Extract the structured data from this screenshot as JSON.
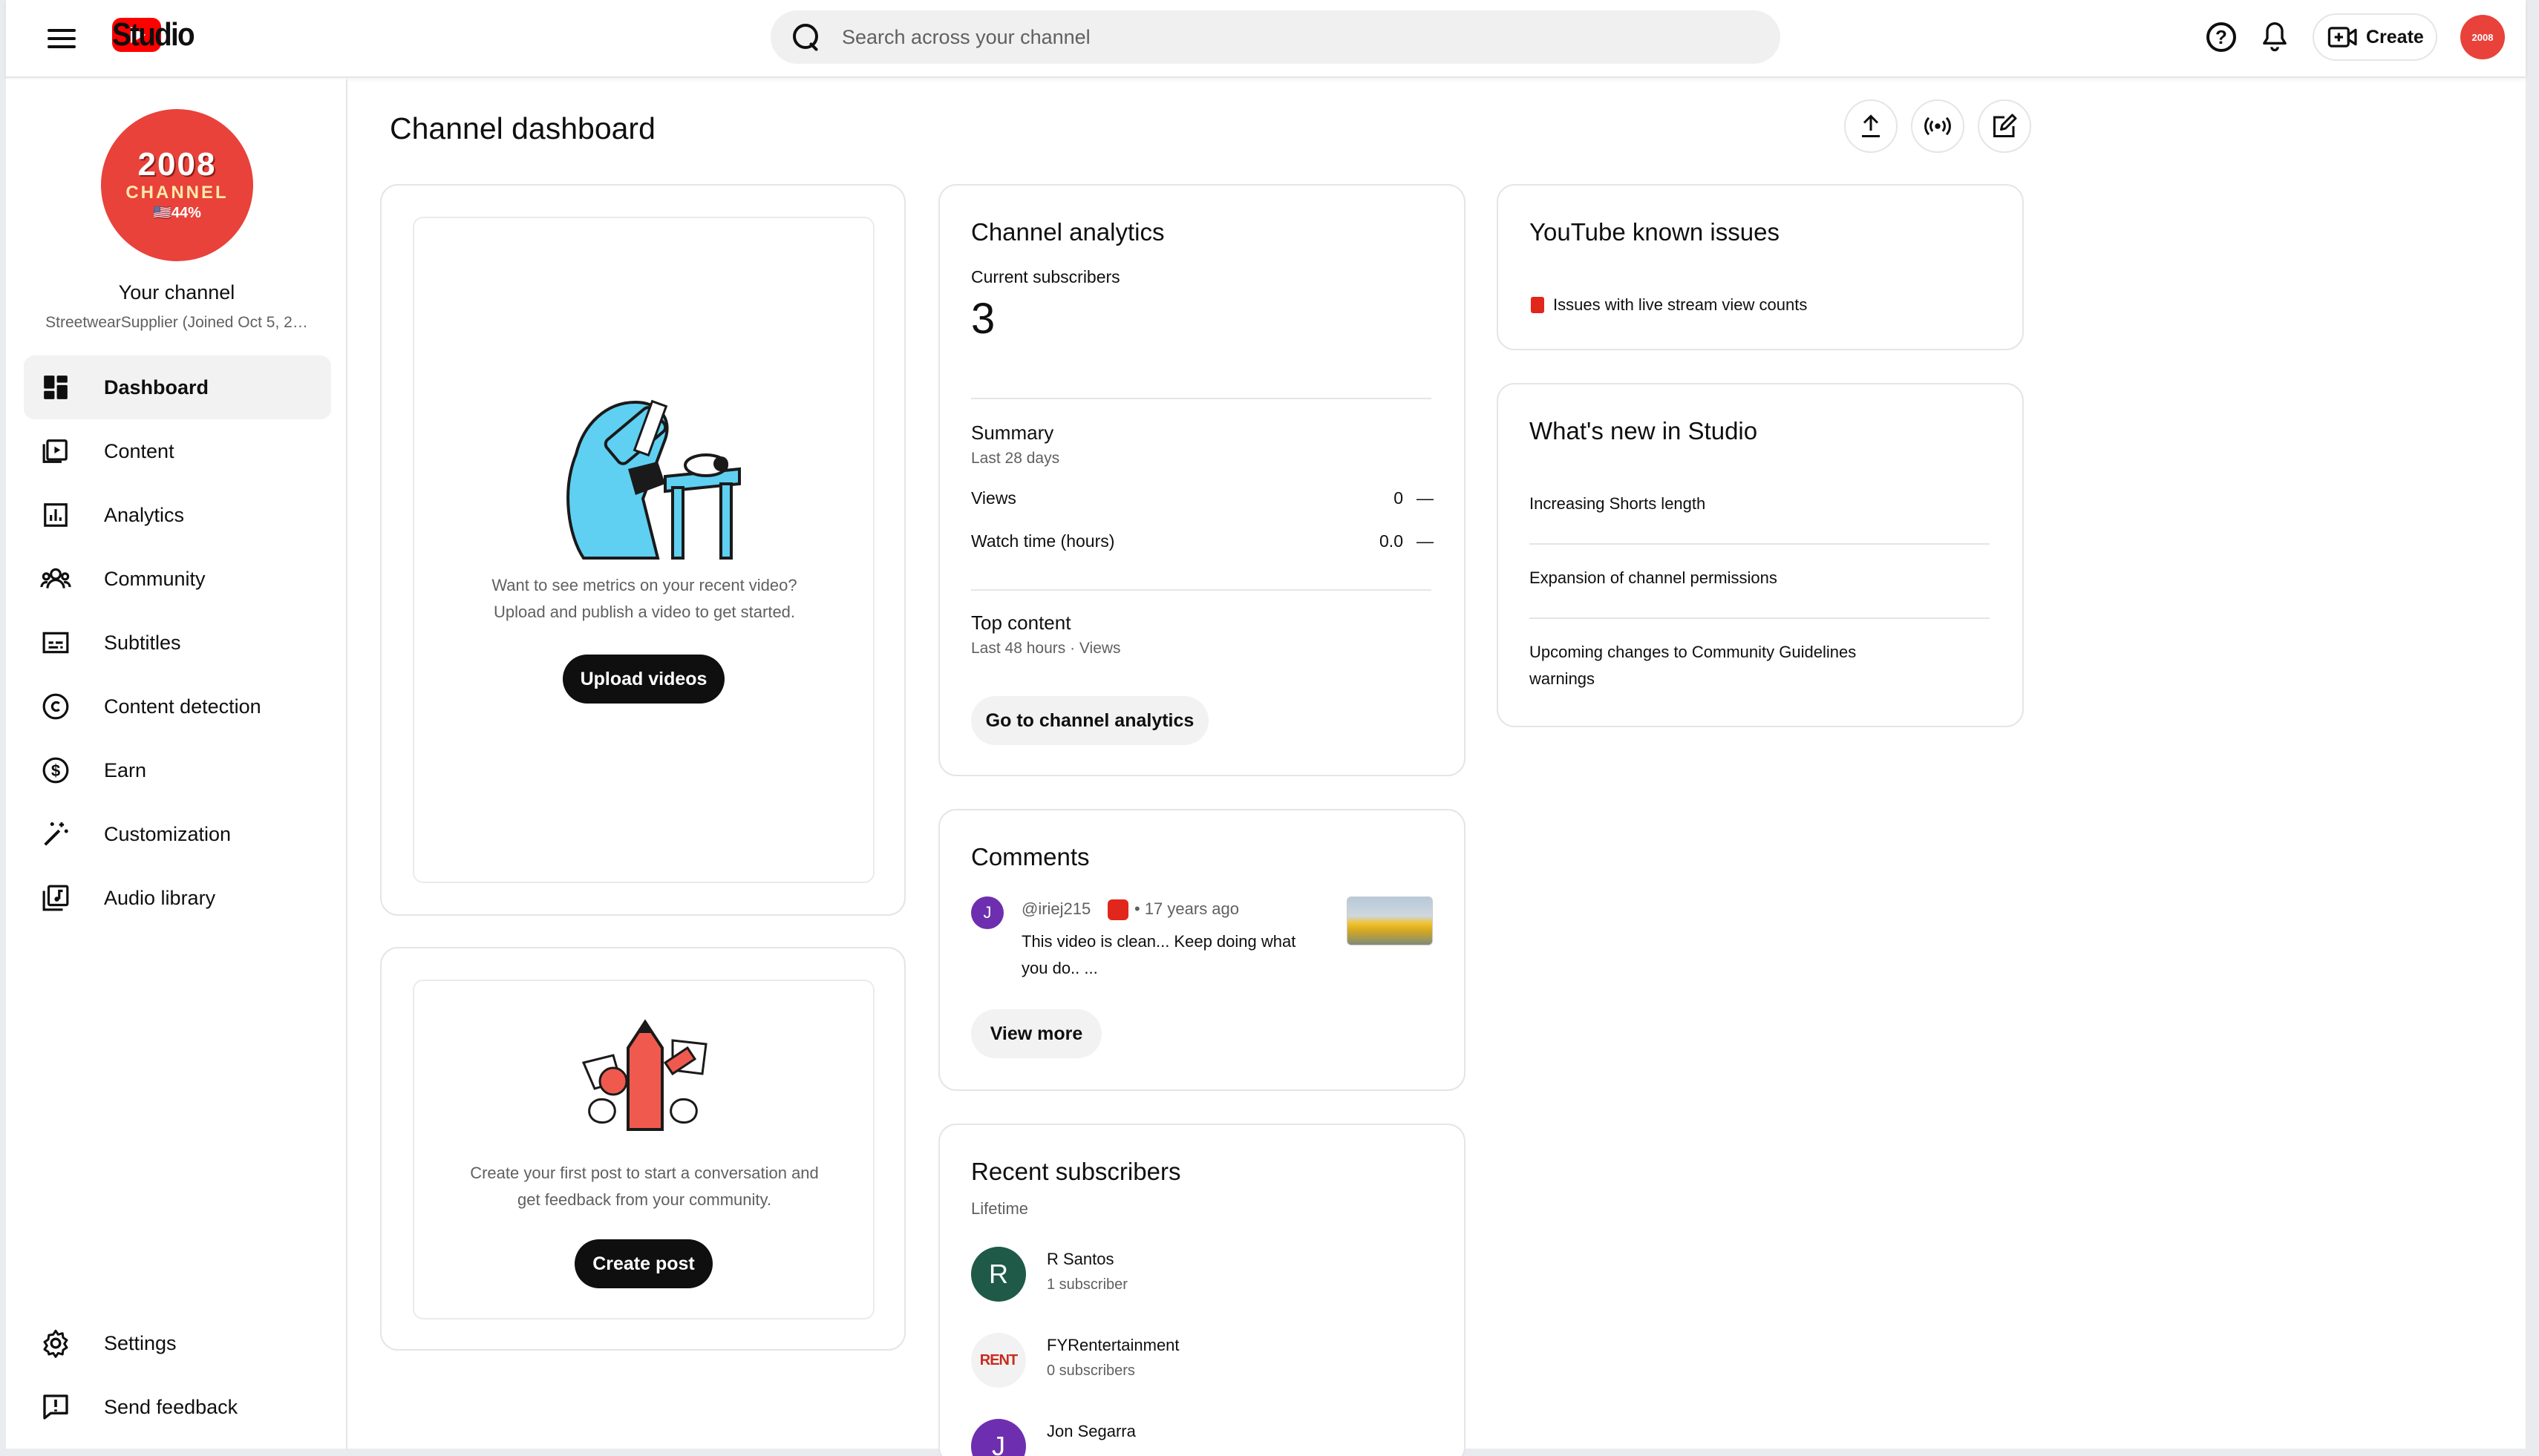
{
  "header": {
    "app_name": "Studio",
    "search_placeholder": "Search across your channel",
    "create_label": "Create",
    "avatar_text": "2008"
  },
  "sidebar": {
    "avatar": {
      "line1": "2008",
      "line2": "CHANNEL",
      "line3": "🇺🇸44%"
    },
    "your_channel": "Your channel",
    "channel_sub": "StreetwearSupplier (Joined Oct 5, 2…",
    "items": [
      {
        "label": "Dashboard",
        "icon": "dashboard-icon",
        "active": true
      },
      {
        "label": "Content",
        "icon": "content-icon"
      },
      {
        "label": "Analytics",
        "icon": "analytics-icon"
      },
      {
        "label": "Community",
        "icon": "community-icon"
      },
      {
        "label": "Subtitles",
        "icon": "subtitles-icon"
      },
      {
        "label": "Content detection",
        "icon": "copyright-icon"
      },
      {
        "label": "Earn",
        "icon": "dollar-icon"
      },
      {
        "label": "Customization",
        "icon": "magic-wand-icon"
      },
      {
        "label": "Audio library",
        "icon": "audio-library-icon"
      }
    ],
    "bottom": [
      {
        "label": "Settings",
        "icon": "gear-icon"
      },
      {
        "label": "Send feedback",
        "icon": "feedback-icon"
      }
    ]
  },
  "main": {
    "title": "Channel dashboard",
    "video_card": {
      "text_line1": "Want to see metrics on your recent video?",
      "text_line2": "Upload and publish a video to get started.",
      "button": "Upload videos"
    },
    "post_card": {
      "text_line1": "Create your first post to start a conversation and",
      "text_line2": "get feedback from your community.",
      "button": "Create post"
    },
    "analytics": {
      "title": "Channel analytics",
      "subs_label": "Current subscribers",
      "subs_value": "3",
      "summary_title": "Summary",
      "summary_period": "Last 28 days",
      "rows": [
        {
          "label": "Views",
          "value": "0",
          "trend": "—"
        },
        {
          "label": "Watch time (hours)",
          "value": "0.0",
          "trend": "—"
        }
      ],
      "top_title": "Top content",
      "top_period": "Last 48 hours · Views",
      "button": "Go to channel analytics"
    },
    "comments": {
      "title": "Comments",
      "author_initial": "J",
      "author": "@iriej215",
      "time": "• 17 years ago",
      "text_line1": "This video is clean... Keep doing what",
      "text_line2": "you do.. ...",
      "button": "View more"
    },
    "recent_subs": {
      "title": "Recent subscribers",
      "period": "Lifetime",
      "items": [
        {
          "initial": "R",
          "name": "R Santos",
          "count": "1 subscriber",
          "color": "#1e5a47"
        },
        {
          "initial": "RENT",
          "name": "FYRentertainment",
          "count": "0 subscribers",
          "color": "#f2f2f2"
        },
        {
          "initial": "J",
          "name": "Jon Segarra",
          "count": "",
          "color": "#6d2fb0"
        }
      ]
    },
    "known_issues": {
      "title": "YouTube known issues",
      "item": "Issues with live stream view counts"
    },
    "whats_new": {
      "title": "What's new in Studio",
      "items": [
        "Increasing Shorts length",
        "Expansion of channel permissions",
        "Upcoming changes to Community Guidelines",
        "warnings"
      ]
    }
  }
}
